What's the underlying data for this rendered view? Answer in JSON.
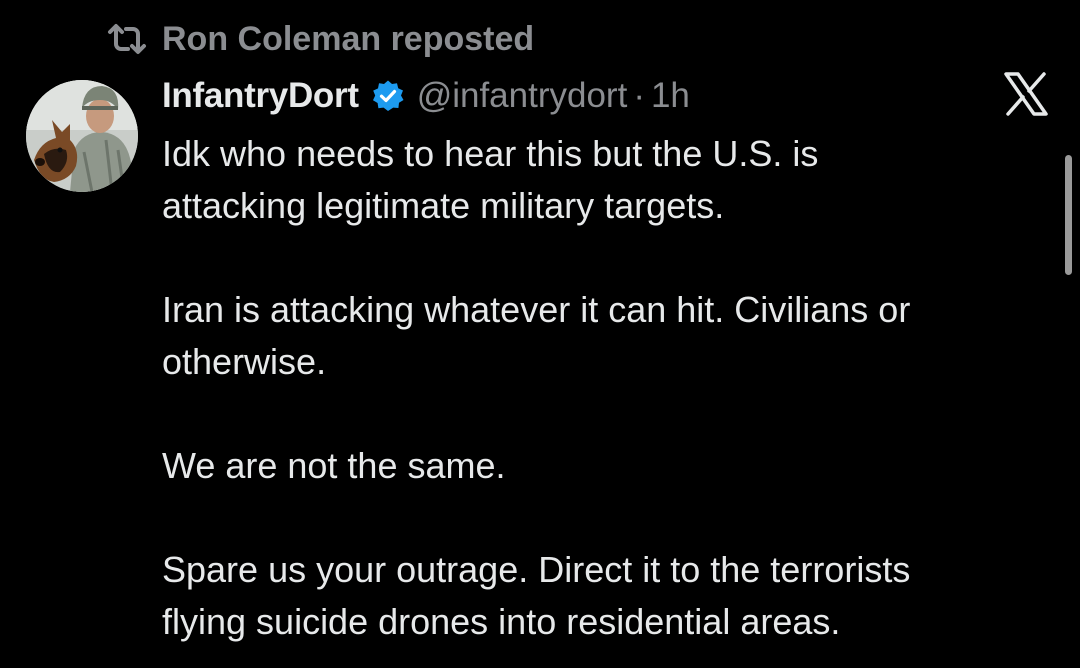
{
  "repost": {
    "icon": "repost-icon",
    "text": "Ron Coleman reposted"
  },
  "author": {
    "display_name": "InfantryDort",
    "verified_icon": "verified-badge-icon",
    "handle": "@infantrydort",
    "separator": "·",
    "time": "1h",
    "avatar": "avatar"
  },
  "tweet": {
    "paragraphs": [
      "Idk who needs to hear this but the U.S. is\nattacking legitimate military targets.",
      "Iran is attacking whatever it can hit. Civilians or\notherwise.",
      "We are not the same.",
      "Spare us your outrage.  Direct it to the terrorists\nflying suicide drones into residential areas."
    ]
  },
  "brand": {
    "logo": "x-logo-icon"
  },
  "colors": {
    "background": "#000000",
    "text": "#e7e9ea",
    "muted": "#8b8d91",
    "verified": "#1d9bf0"
  }
}
